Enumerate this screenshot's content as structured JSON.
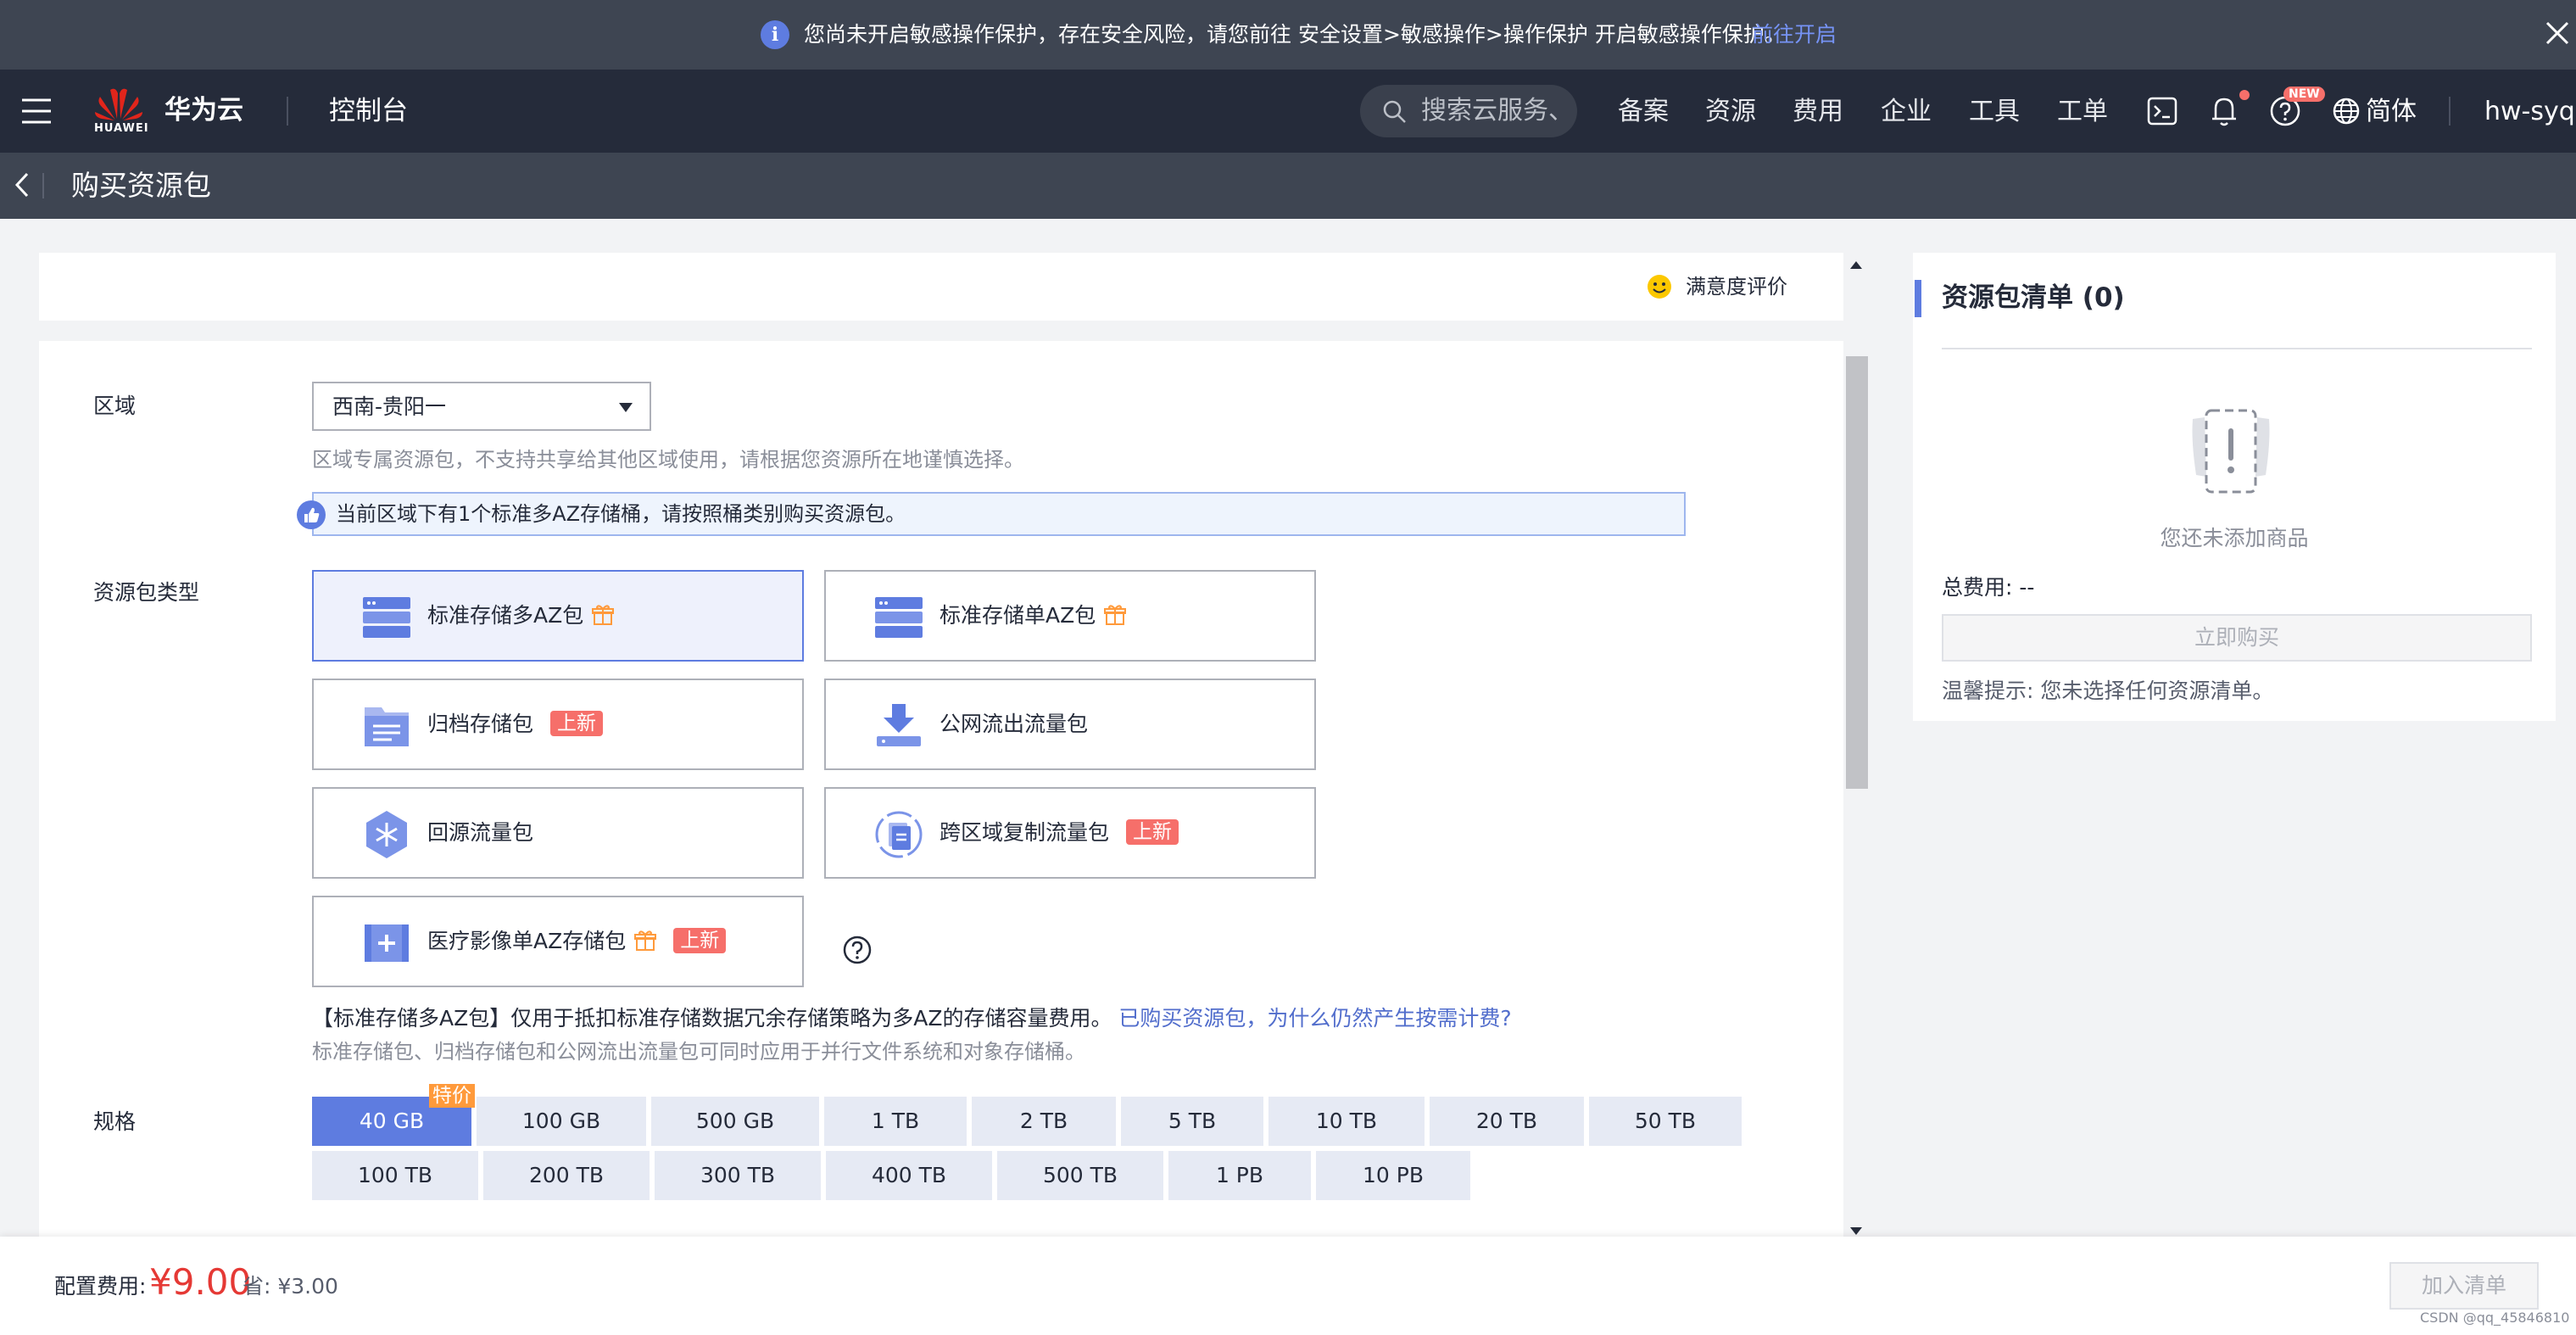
{
  "notice": {
    "text": "您尚未开启敏感操作保护，存在安全风险，请您前往 安全设置>敏感操作>操作保护 开启敏感操作保护。",
    "link": "前往开启",
    "icon": "info-icon",
    "close_icon": "close-icon"
  },
  "topnav": {
    "logo_word": "HUAWEI",
    "brand": "华为云",
    "console": "控制台",
    "search_placeholder": "搜索云服务、",
    "items": [
      "备案",
      "资源",
      "费用",
      "企业",
      "工具",
      "工单"
    ],
    "new_badge": "NEW",
    "language": "简体",
    "user": "hw-syq",
    "icons": [
      "menu-icon",
      "search-icon",
      "terminal-icon",
      "bell-icon",
      "help-icon",
      "globe-icon"
    ]
  },
  "page": {
    "title": "购买资源包"
  },
  "satisfaction": "满意度评价",
  "form": {
    "region_label": "区域",
    "region_value": "西南-贵阳一",
    "region_hint": "区域专属资源包，不支持共享给其他区域使用，请根据您资源所在地谨慎选择。",
    "region_tip": "当前区域下有1个标准多AZ存储桶，请按照桶类别购买资源包。",
    "type_label": "资源包类型",
    "packages": [
      {
        "name": "标准存储多AZ包",
        "gift": true,
        "new": "",
        "selected": true
      },
      {
        "name": "标准存储单AZ包",
        "gift": true,
        "new": "",
        "selected": false
      },
      {
        "name": "归档存储包",
        "gift": false,
        "new": "上新",
        "selected": false
      },
      {
        "name": "公网流出流量包",
        "gift": false,
        "new": "",
        "selected": false
      },
      {
        "name": "回源流量包",
        "gift": false,
        "new": "",
        "selected": false
      },
      {
        "name": "跨区域复制流量包",
        "gift": false,
        "new": "上新",
        "selected": false
      },
      {
        "name": "医疗影像单AZ存储包",
        "gift": true,
        "new": "上新",
        "selected": false
      }
    ],
    "desc_main": "【标准存储多AZ包】仅用于抵扣标准存储数据冗余存储策略为多AZ的存储容量费用。",
    "desc_link": "已购买资源包，为什么仍然产生按需计费?",
    "desc_sub": "标准存储包、归档存储包和公网流出流量包可同时应用于并行文件系统和对象存储桶。",
    "spec_label": "规格",
    "spec_tag": "特价",
    "specs_row1": [
      "40 GB",
      "100 GB",
      "500 GB",
      "1 TB",
      "2 TB",
      "5 TB",
      "10 TB",
      "20 TB",
      "50 TB"
    ],
    "specs_row2": [
      "100 TB",
      "200 TB",
      "300 TB",
      "400 TB",
      "500 TB",
      "1 PB",
      "10 PB"
    ],
    "selected_spec": "40 GB"
  },
  "cart": {
    "title": "资源包清单 (0)",
    "empty": "您还未添加商品",
    "total": "总费用: --",
    "buy": "立即购买",
    "tip": "温馨提示:  您未选择任何资源清单。"
  },
  "bottom": {
    "config_label": "配置费用:",
    "price": "¥9.00",
    "save": "省: ¥3.00",
    "add": "加入清单"
  },
  "watermark": "CSDN @qq_45846810",
  "colors": {
    "accent": "#5e7ce0",
    "danger": "#f66f6a",
    "price": "#e53935",
    "tag": "#ff9a3b"
  }
}
